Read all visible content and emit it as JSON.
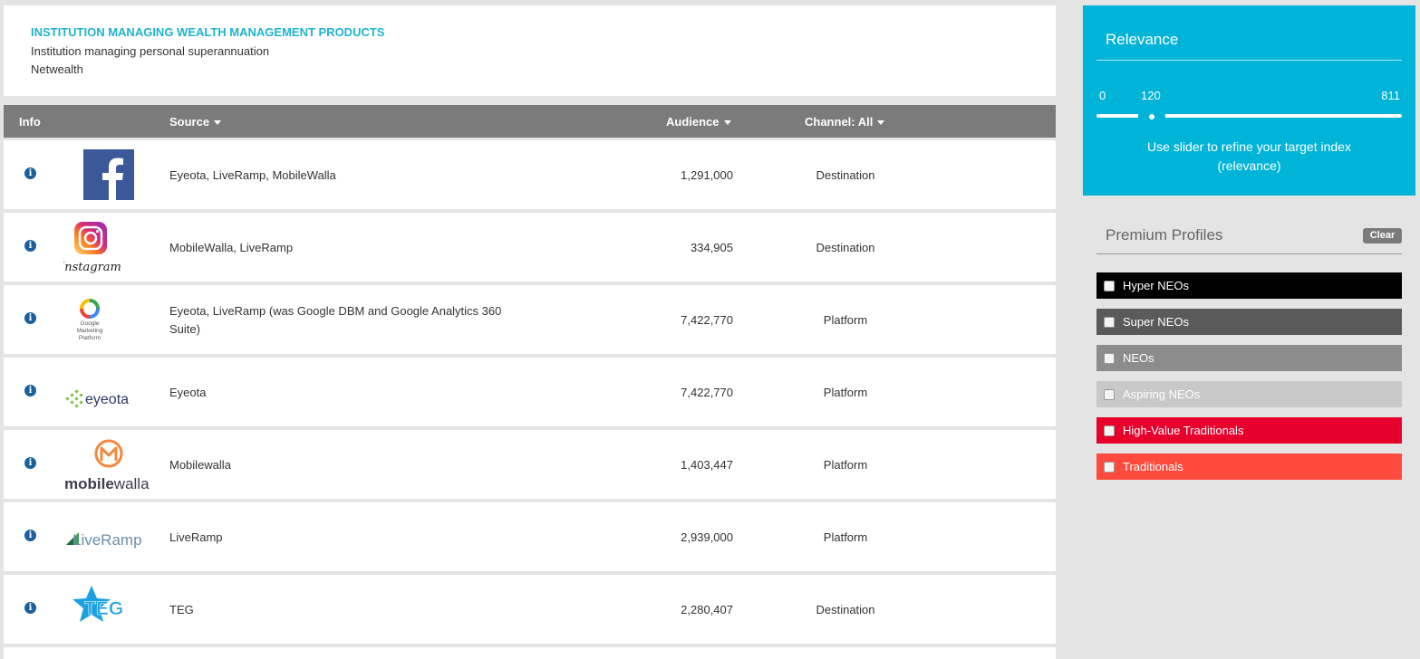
{
  "header": {
    "title": "INSTITUTION MANAGING WEALTH MANAGEMENT PRODUCTS",
    "subtitle": "Institution managing personal superannuation",
    "subtitle2": "Netwealth"
  },
  "table": {
    "columns": {
      "info": "Info",
      "source": "Source",
      "audience": "Audience",
      "channel": "Channel: All"
    },
    "rows": [
      {
        "logo": "facebook-logo",
        "source": "Eyeota, LiveRamp, MobileWalla",
        "audience": "1,291,000",
        "channel": "Destination"
      },
      {
        "logo": "instagram-logo",
        "logo_text": "Instagram",
        "source": "MobileWalla, LiveRamp",
        "audience": "334,905",
        "channel": "Destination"
      },
      {
        "logo": "google-marketing-platform-logo",
        "logo_text": "Google Marketing Platform",
        "source": "Eyeota, LiveRamp (was Google DBM and Google Analytics 360 Suite)",
        "audience": "7,422,770",
        "channel": "Platform"
      },
      {
        "logo": "eyeota-logo",
        "logo_text": "eyeota",
        "source": "Eyeota",
        "audience": "7,422,770",
        "channel": "Platform"
      },
      {
        "logo": "mobilewalla-logo",
        "logo_text": "mobilewalla",
        "source": "Mobilewalla",
        "audience": "1,403,447",
        "channel": "Platform"
      },
      {
        "logo": "liveramp-logo",
        "logo_text": "LiveRamp",
        "source": "LiveRamp",
        "audience": "2,939,000",
        "channel": "Platform"
      },
      {
        "logo": "teg-logo",
        "logo_text": "TEG",
        "source": "TEG",
        "audience": "2,280,407",
        "channel": "Destination"
      }
    ]
  },
  "relevance": {
    "title": "Relevance",
    "min": "0",
    "value": "120",
    "max": "811",
    "help": "Use slider to refine your target index (relevance)"
  },
  "premium_profiles": {
    "title": "Premium Profiles",
    "clear_label": "Clear",
    "items": [
      {
        "label": "Hyper NEOs",
        "color": "#000000",
        "checked": false
      },
      {
        "label": "Super NEOs",
        "color": "#5a5a5a",
        "checked": false
      },
      {
        "label": "NEOs",
        "color": "#8c8c8c",
        "checked": false
      },
      {
        "label": "Aspiring NEOs",
        "color": "#c8c8c8",
        "checked": false
      },
      {
        "label": "High-Value Traditionals",
        "color": "#e8002d",
        "checked": false
      },
      {
        "label": "Traditionals",
        "color": "#ff4a3d",
        "checked": false
      }
    ]
  },
  "colors": {
    "accent": "#00b4d8",
    "header_bar": "#7b7b7b",
    "info_icon": "#1b5f9b"
  }
}
